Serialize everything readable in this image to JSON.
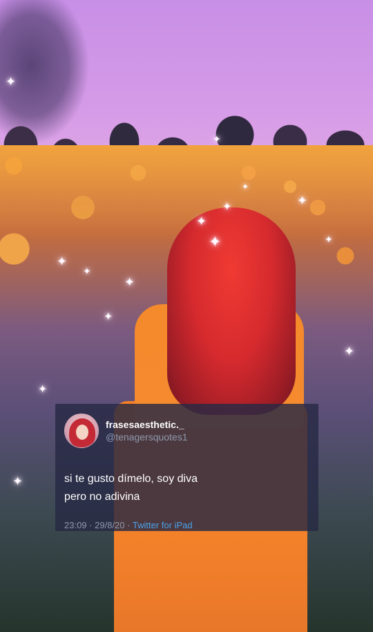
{
  "tweet": {
    "display_name": "frasesaesthetic._",
    "handle": "@tenagersquotes1",
    "text_lines": [
      "si te gusto dímelo, soy diva",
      "pero no adivina"
    ],
    "time": "23:09",
    "separator": "·",
    "date": "29/8/20",
    "source": "Twitter for iPad"
  },
  "icons": {
    "sparkle": "✦"
  },
  "colors": {
    "card_background": "#27294499",
    "handle_gray": "#8f99ad",
    "source_blue": "#4aa2ea"
  }
}
